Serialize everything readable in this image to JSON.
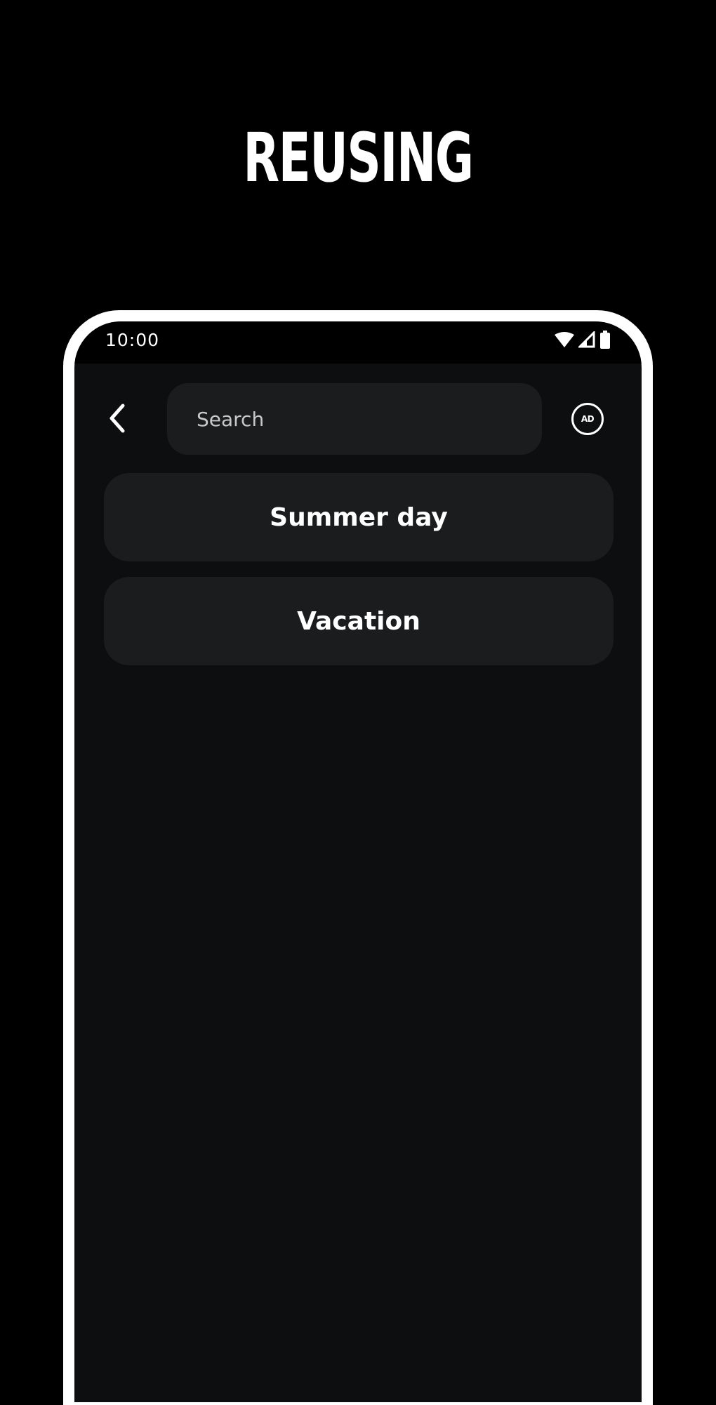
{
  "headline": "REUSING",
  "status_bar": {
    "time": "10:00",
    "icons": [
      "wifi-icon",
      "signal-icon",
      "battery-icon"
    ]
  },
  "top_bar": {
    "back_icon": "chevron-left-icon",
    "search": {
      "placeholder": "Search",
      "value": ""
    },
    "ad_badge": "AD"
  },
  "results": [
    {
      "label": "Summer day"
    },
    {
      "label": "Vacation"
    }
  ],
  "colors": {
    "background": "#000000",
    "screen": "#0d0e10",
    "card": "#1b1c1e",
    "text": "#ffffff",
    "frame": "#ffffff"
  }
}
